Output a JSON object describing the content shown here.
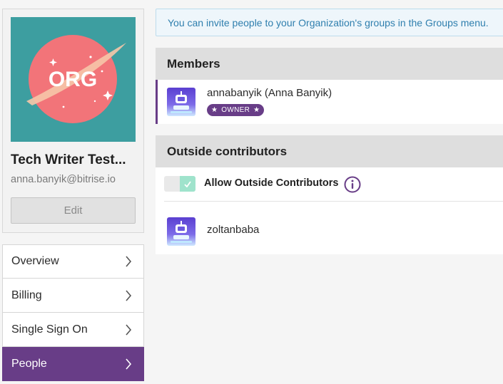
{
  "org": {
    "logo_text": "ORG",
    "name": "Tech Writer Test...",
    "email": "anna.banyik@bitrise.io",
    "edit_label": "Edit"
  },
  "nav": {
    "items": [
      {
        "label": "Overview",
        "active": false
      },
      {
        "label": "Billing",
        "active": false
      },
      {
        "label": "Single Sign On",
        "active": false
      },
      {
        "label": "People",
        "active": true
      }
    ]
  },
  "banner": {
    "text": "You can invite people to your Organization's groups in the Groups menu."
  },
  "members": {
    "title": "Members",
    "list": [
      {
        "name": "annabanyik (Anna Banyik)",
        "badge": "OWNER"
      }
    ]
  },
  "outside": {
    "title": "Outside contributors",
    "toggle_label": "Allow Outside Contributors",
    "toggle_on": true,
    "contributors": [
      {
        "name": "zoltanbaba"
      }
    ]
  },
  "colors": {
    "brand_purple": "#683d87",
    "logo_bg": "#3d9ea0",
    "logo_circle": "#f27479",
    "banner_text": "#2f7fae",
    "toggle_knob": "#9fe3cc"
  }
}
